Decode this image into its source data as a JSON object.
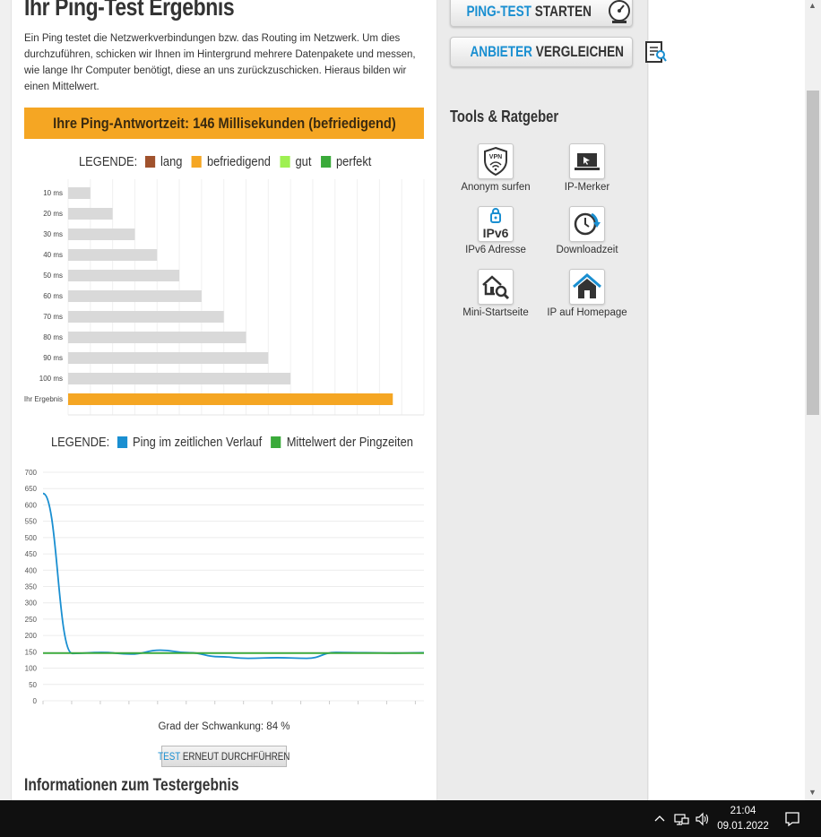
{
  "page": {
    "title": "Ihr Ping-Test Ergebnis",
    "intro": "Ein Ping testet die Netzwerkverbindungen bzw. das Routing im Netzwerk. Um dies durchzuführen, schicken wir Ihnen im Hintergrund mehrere Datenpakete und messen, wie lange Ihr Computer benötigt, diese an uns zurückzuschicken. Hieraus bilden wir einen Mittelwert.",
    "result_banner": "Ihre Ping-Antwortzeit: 146 Millisekunden (befriedigend)",
    "fluctuation": "Grad der Schwankung: 84 %",
    "retest_part1": "TEST",
    "retest_part2": " ERNEUT DURCHFÜHREN",
    "info_title": "Informationen zum Testergebnis"
  },
  "legend1": {
    "label": "LEGENDE:",
    "items": [
      {
        "name": "lang",
        "color": "#a0522d"
      },
      {
        "name": "befriedigend",
        "color": "#f5a623"
      },
      {
        "name": "gut",
        "color": "#9ef052"
      },
      {
        "name": "perfekt",
        "color": "#3aaa3a"
      }
    ]
  },
  "legend2": {
    "label": "LEGENDE:",
    "items": [
      {
        "name": "Ping im zeitlichen Verlauf",
        "color": "#1a8fd1"
      },
      {
        "name": "Mittelwert der Pingzeiten",
        "color": "#3aaa3a"
      }
    ]
  },
  "chart_data": [
    {
      "type": "bar",
      "orientation": "horizontal",
      "categories": [
        "10 ms",
        "20 ms",
        "30 ms",
        "40 ms",
        "50 ms",
        "60 ms",
        "70 ms",
        "80 ms",
        "90 ms",
        "100 ms",
        "Ihr Ergebnis"
      ],
      "values": [
        10,
        20,
        30,
        40,
        50,
        60,
        70,
        80,
        90,
        100,
        146
      ],
      "colors": [
        "#d9d9d9",
        "#d9d9d9",
        "#d9d9d9",
        "#d9d9d9",
        "#d9d9d9",
        "#d9d9d9",
        "#d9d9d9",
        "#d9d9d9",
        "#d9d9d9",
        "#d9d9d9",
        "#f5a623"
      ],
      "xlim": [
        0,
        160
      ],
      "grid": true
    },
    {
      "type": "line",
      "ylim": [
        0,
        700
      ],
      "yticks": [
        0,
        50,
        100,
        150,
        200,
        250,
        300,
        350,
        400,
        450,
        500,
        550,
        600,
        650,
        700
      ],
      "grid": true,
      "series": [
        {
          "name": "Ping im zeitlichen Verlauf",
          "color": "#1a8fd1",
          "values": [
            635,
            145,
            148,
            143,
            155,
            147,
            135,
            130,
            132,
            130,
            148,
            147,
            146,
            147
          ]
        },
        {
          "name": "Mittelwert der Pingzeiten",
          "color": "#3aaa3a",
          "values": [
            146,
            146,
            146,
            146,
            146,
            146,
            146,
            146,
            146,
            146,
            146,
            146,
            146,
            146
          ]
        }
      ]
    }
  ],
  "sidebar": {
    "btn_ping_part1": "PING-TEST",
    "btn_ping_part2": " STARTEN",
    "btn_anbieter_part1": "ANBIETER",
    "btn_anbieter_part2": " VERGLEICHEN",
    "tools_title": "Tools & Ratgeber",
    "tools": [
      {
        "label": "Anonym surfen",
        "icon": "vpn-shield-icon"
      },
      {
        "label": "IP-Merker",
        "icon": "laptop-icon"
      },
      {
        "label": "IPv6 Adresse",
        "icon": "ipv6-lock-icon"
      },
      {
        "label": "Downloadzeit",
        "icon": "download-clock-icon"
      },
      {
        "label": "Mini-Startseite",
        "icon": "house-search-icon"
      },
      {
        "label": "IP auf Homepage",
        "icon": "house-icon"
      }
    ],
    "vpn_text": "VPN",
    "ipv6_text": "IPv6"
  },
  "taskbar": {
    "time": "21:04",
    "date": "09.01.2022"
  }
}
